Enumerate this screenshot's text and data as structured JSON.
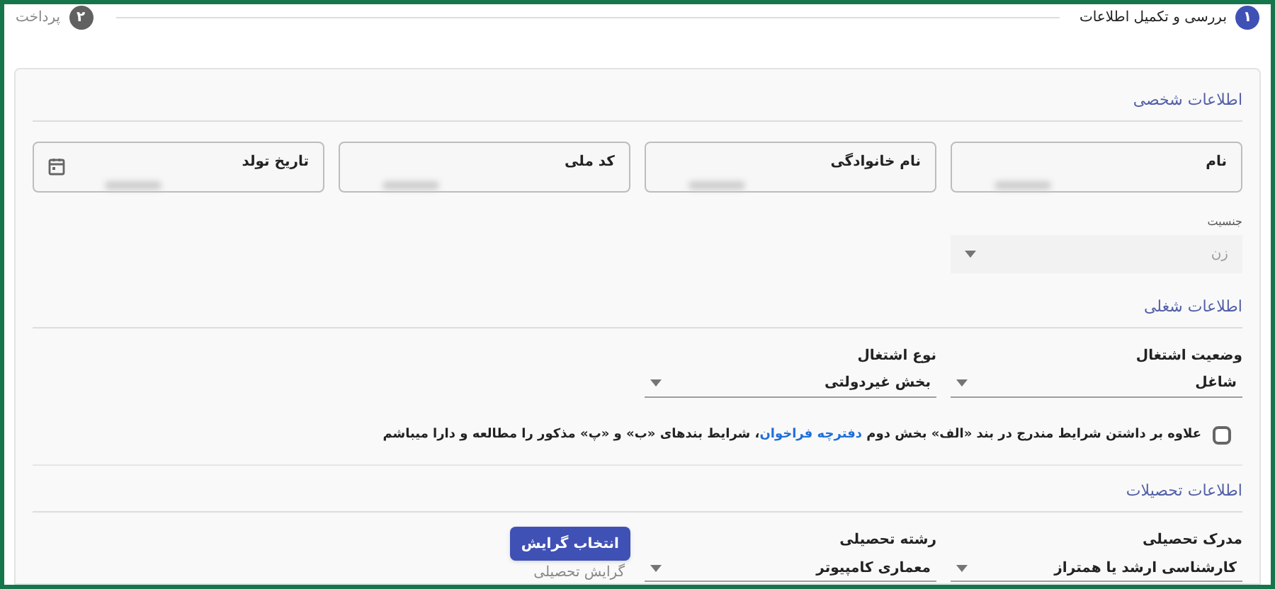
{
  "stepper": [
    {
      "number": "۱",
      "label": "بررسی و تکمیل اطلاعات",
      "selected": true
    },
    {
      "number": "۲",
      "label": "پرداخت",
      "selected": false
    }
  ],
  "sections": [
    {
      "title": "اطلاعات شخصی",
      "fields": [
        {
          "kind": "text",
          "label": "نام",
          "redacted": true
        },
        {
          "kind": "text",
          "label": "نام خانوادگی",
          "redacted": true
        },
        {
          "kind": "text",
          "label": "کد ملی",
          "redacted": true
        },
        {
          "kind": "date",
          "label": "تاریخ تولد",
          "redacted": true
        },
        {
          "kind": "select",
          "label": "جنسیت",
          "value": "زن",
          "disabled": true
        }
      ]
    },
    {
      "title": "اطلاعات شغلی",
      "fields": [
        {
          "kind": "select",
          "label": "وضعیت اشتغال",
          "value": "شاغل",
          "disabled": false
        },
        {
          "kind": "select",
          "label": "نوع اشتغال",
          "value": "بخش غیردولتی",
          "disabled": false
        }
      ],
      "agreement": {
        "checked": false,
        "before": "علاوه بر داشتن شرایط مندرج در بند «الف» بخش دوم ",
        "link": "دفترچه فراخوان",
        "after": "، شرایط بندهای «ب» و «پ» مذکور را مطالعه و دارا میباشم"
      }
    },
    {
      "title": "اطلاعات تحصیلات",
      "fields": [
        {
          "kind": "select",
          "label": "مدرک تحصیلی",
          "value": "کارشناسی ارشد یا همتراز",
          "disabled": false
        },
        {
          "kind": "select",
          "label": "رشته تحصیلی",
          "value": "معماری کامپیوتر",
          "disabled": false
        },
        {
          "kind": "button",
          "label": "انتخاب گرایش",
          "placeholder": "گرایش تحصیلی"
        }
      ]
    }
  ]
}
